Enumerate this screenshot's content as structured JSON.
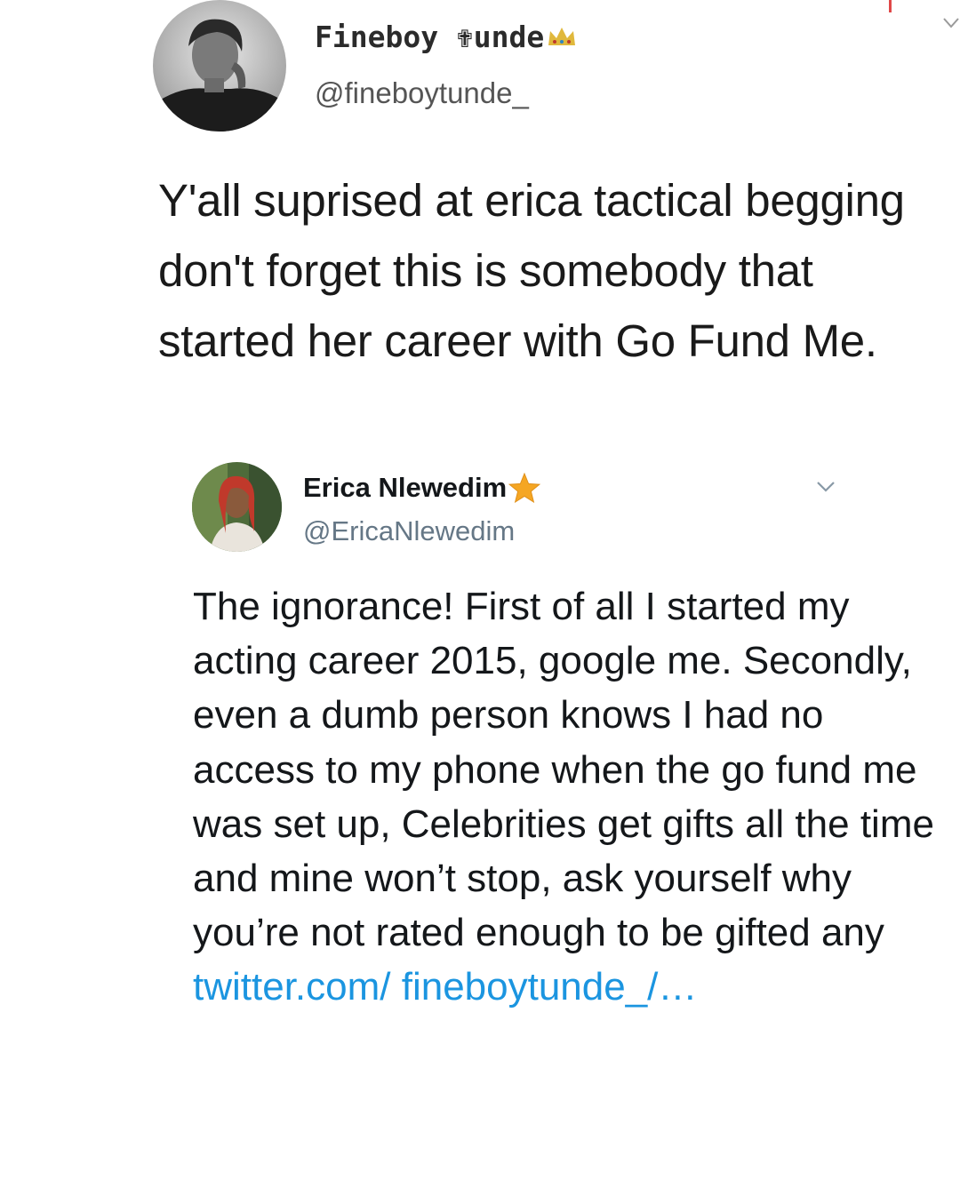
{
  "tweet1": {
    "display_name": "Fineboy ✟unde",
    "handle": "@fineboytunde_",
    "text": "Y'all suprised at erica tactical begging don't forget this is somebody that started her career with Go Fund Me."
  },
  "tweet2": {
    "display_name": "Erica Nlewedim",
    "handle": "@EricaNlewedim",
    "text": "The ignorance! First of all I started my acting career 2015, google me. Secondly, even a dumb person knows I had no access to my phone when the go fund me was set up, Celebrities get gifts all the time and mine won’t stop, ask yourself why you’re not rated enough to be gifted any",
    "link_text": "twitter.com/ fineboytunde_/…"
  },
  "colors": {
    "link": "#1b95e0",
    "star": "#f5a623",
    "handle": "#657786"
  },
  "icons": {
    "crown": "crown-icon",
    "star": "star-icon",
    "chevron": "chevron-down-icon"
  }
}
